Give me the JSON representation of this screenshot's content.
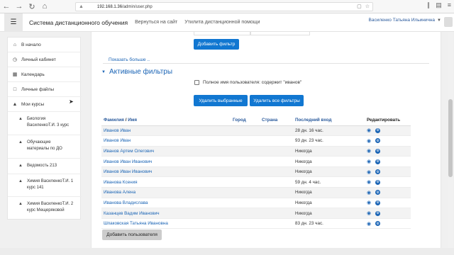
{
  "browser": {
    "url_host": "192.168.1.36",
    "url_path": "/admin/user.php",
    "icons": [
      "back-icon",
      "forward-icon",
      "reload-icon",
      "home-icon",
      "shield-icon",
      "info-icon",
      "bookmark-icon",
      "star-icon",
      "library-icon",
      "reader-icon",
      "menu-icon"
    ]
  },
  "topbar": {
    "site_name": "Система дистанционного обучения",
    "link_back": "Вернуться на сайт",
    "link_help": "Утилита дистанционной помощи",
    "user_name": "Василенко Татьяна Ильинична"
  },
  "sidebar": {
    "items": [
      {
        "label": "В начало",
        "icon": "home-icon"
      },
      {
        "label": "Личный кабинет",
        "icon": "dashboard-icon"
      },
      {
        "label": "Календарь",
        "icon": "calendar-icon"
      },
      {
        "label": "Личные файлы",
        "icon": "file-icon"
      },
      {
        "label": "Мои курсы",
        "icon": "graduation-cap-icon"
      }
    ],
    "courses": [
      {
        "line1": "Биология",
        "line2": "ВасиленкоТ.И. 3 курс"
      },
      {
        "line1": "Обучающие",
        "line2": "материалы по ДО"
      },
      {
        "line1": "Ведомость 213",
        "line2": ""
      },
      {
        "line1": "Химия ВасиленкоТ.И. 1",
        "line2": "курс 141"
      },
      {
        "line1": "Химия ВасиленкоТ.И. 2",
        "line2": "курс Мещеряковой"
      }
    ]
  },
  "filters": {
    "add_filter_button": "Добавить фильтр",
    "show_more": "Показать больше ..",
    "active_title": "Активные фильтры",
    "active_filter_label": "Полное имя пользователя: содержит \"иванов\"",
    "remove_selected_button": "Удалить выбранные",
    "remove_all_button": "Удалить все фильтры"
  },
  "table": {
    "headers": {
      "name_first": "Фамилия",
      "name_sep": " / ",
      "name_second": "Имя",
      "city": "Город",
      "country": "Страна",
      "last_login": "Последний вход",
      "edit": "Редактировать"
    },
    "rows": [
      {
        "name": "Иванов Иван",
        "city": "",
        "country": "",
        "last_login": "28 дн. 16 час."
      },
      {
        "name": "Иванов Иван",
        "city": "",
        "country": "",
        "last_login": "93 дн. 23 час."
      },
      {
        "name": "Иванов Артем Олегович",
        "city": "",
        "country": "",
        "last_login": "Никогда"
      },
      {
        "name": "Иванов Иван Иванович",
        "city": "",
        "country": "",
        "last_login": "Никогда"
      },
      {
        "name": "Иванов Иван Иванович",
        "city": "",
        "country": "",
        "last_login": "Никогда"
      },
      {
        "name": "Иванова Ксения",
        "city": "",
        "country": "",
        "last_login": "59 дн. 4 час."
      },
      {
        "name": "Иванова Алена",
        "city": "",
        "country": "",
        "last_login": "Никогда"
      },
      {
        "name": "Иванова Владислава",
        "city": "",
        "country": "",
        "last_login": "Никогда"
      },
      {
        "name": "Казанцев Вадим Иванович",
        "city": "",
        "country": "",
        "last_login": "Никогда"
      },
      {
        "name": "Шпаковская Татьяна Ивановна",
        "city": "",
        "country": "",
        "last_login": "83 дн. 23 час."
      }
    ]
  },
  "add_user_button": "Добавить пользователя",
  "colors": {
    "primary": "#1177d1",
    "link": "#1a64b5"
  }
}
